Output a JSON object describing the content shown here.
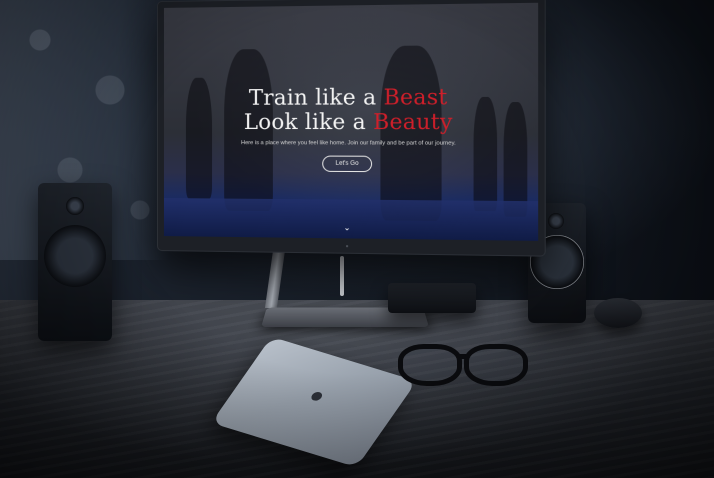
{
  "screen": {
    "headline_1_prefix": "Train like a ",
    "headline_1_accent": "Beast",
    "headline_2_prefix": "Look like a ",
    "headline_2_accent": "Beauty",
    "subtitle": "Here is a place where you feel like home. Join our family and be part of our journey.",
    "cta_label": "Let's Go",
    "scroll_icon": "chevron-down-icon"
  },
  "colors": {
    "accent": "#cf1f2a",
    "headline": "#f3f3f3"
  },
  "icons": {
    "apple": "apple-logo-icon",
    "bezel": "lg-logo-icon"
  }
}
